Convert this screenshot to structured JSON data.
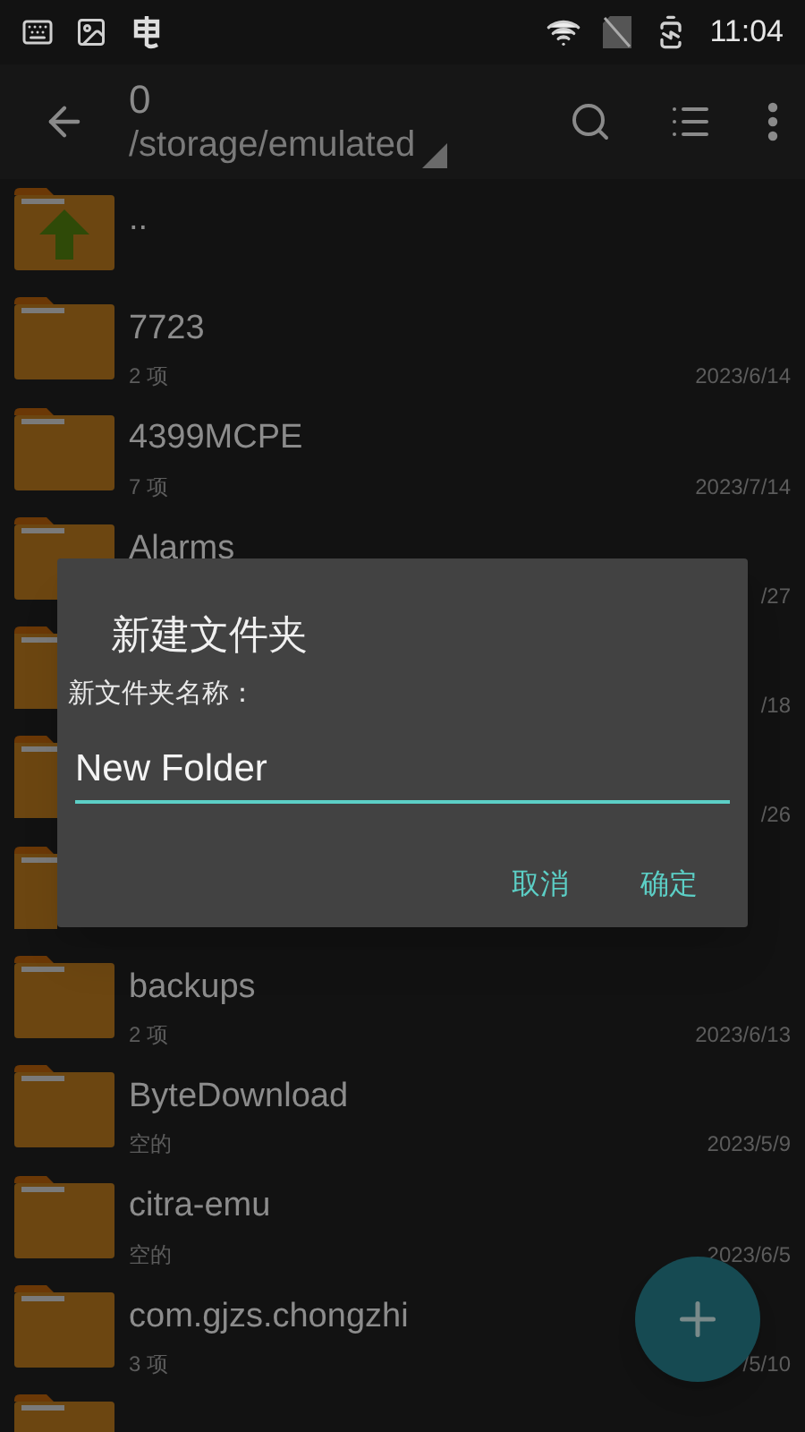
{
  "status_bar": {
    "time": "11:04"
  },
  "toolbar": {
    "title": "0",
    "path": "/storage/emulated"
  },
  "rows": [
    {
      "kind": "parent",
      "name": ".."
    },
    {
      "kind": "folder",
      "name": "7723",
      "meta": "2 项",
      "date": "2023/6/14"
    },
    {
      "kind": "folder",
      "name": "4399MCPE",
      "meta": "7 项",
      "date": "2023/7/14"
    },
    {
      "kind": "folder",
      "name": "Alarms",
      "date": "/27"
    },
    {
      "kind": "covered",
      "date": "/18"
    },
    {
      "kind": "covered",
      "date": "/26"
    },
    {
      "kind": "covered"
    },
    {
      "kind": "folder",
      "name": "backups",
      "meta": "2 项",
      "date": "2023/6/13"
    },
    {
      "kind": "folder",
      "name": "ByteDownload",
      "meta": "空的",
      "date": "2023/5/9"
    },
    {
      "kind": "folder",
      "name": "citra-emu",
      "meta": "空的",
      "date": "2023/6/5"
    },
    {
      "kind": "folder",
      "name": "com.gjzs.chongzhi",
      "meta": "3 项",
      "date": "/5/10"
    },
    {
      "kind": "folder"
    }
  ],
  "dialog": {
    "title": "新建文件夹",
    "label": "新文件夹名称：",
    "value": "New Folder",
    "buttons": [
      "取消",
      "确定"
    ]
  }
}
